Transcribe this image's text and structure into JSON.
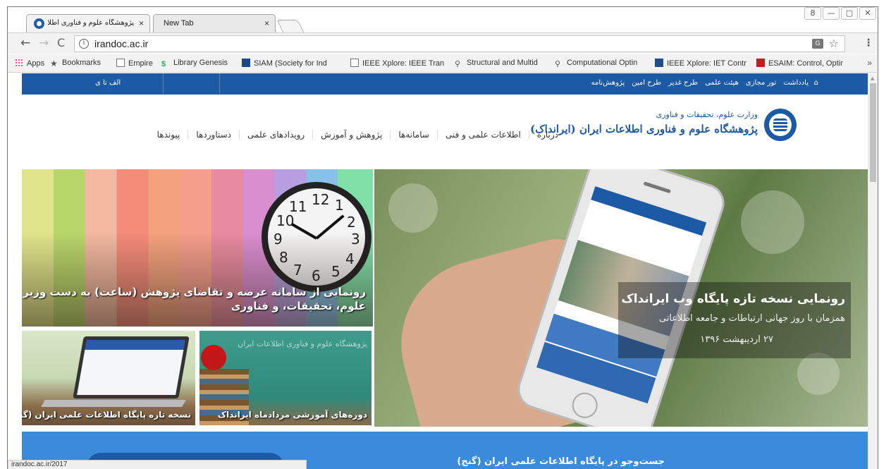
{
  "browser": {
    "tabs": [
      {
        "title": "پژوهشگاه علوم و فناوری اطلاعات ایران",
        "close": "×"
      },
      {
        "title": "New Tab",
        "close": "×"
      }
    ],
    "window_controls": [
      "8",
      "—",
      "▢",
      "✕"
    ],
    "url": "irandoc.ac.ir",
    "bookmarks": [
      {
        "label": "Apps",
        "icon": "apps-icon"
      },
      {
        "label": "Bookmarks",
        "icon": "star-icon"
      },
      {
        "label": "Empire",
        "icon": "page-icon"
      },
      {
        "label": "Library Genesis",
        "icon": "library-genesis-icon"
      },
      {
        "label": "SIAM (Society for Ind",
        "icon": "siam-icon"
      },
      {
        "label": "IEEE Xplore: IEEE Tran",
        "icon": "page-icon"
      },
      {
        "label": "Structural and Multid",
        "icon": "springer-icon"
      },
      {
        "label": "Computational Optin",
        "icon": "springer-icon"
      },
      {
        "label": "IEEE Xplore: IET Contr",
        "icon": "ieee-icon"
      },
      {
        "label": "ESAIM: Control, Optir",
        "icon": "esaim-icon"
      }
    ],
    "bookmarks_more": "»",
    "status_text": "irandoc.ac.ir/2017"
  },
  "site": {
    "topbar_links": [
      "یادداشت",
      "تور مجازی",
      "هیئت علمی",
      "طرح غدیر",
      "طرح امین",
      "پژوهش‌نامه"
    ],
    "topbar_az": "الف تا ی",
    "brand_sub": "وزارت علوم، تحقیقات و فناوری",
    "brand_main": "پژوهشگاه علوم و فناوری اطلاعات ایران (ایرانداک)",
    "nav": [
      "درباره",
      "اطلاعات علمی و فنی",
      "سامانه‌ها",
      "پژوهش و آموزش",
      "رویدادهای علمی",
      "دستاوردها",
      "پیوندها"
    ],
    "clock_numbers": [
      "12",
      "1",
      "2",
      "3",
      "4",
      "5",
      "6",
      "7",
      "8",
      "9",
      "10",
      "11"
    ],
    "tile_colors_caption": "رونمایی از سامانه عرضه و تقاضای پژوهش (ساعت) به دست وزیر علوم، تحقیقات، و فناوری",
    "phone_title": "رونمایی نسخه تازه پایگاه وب ایرانداک",
    "phone_subtitle": "همزمان با روز جهانی ارتباطات و جامعه اطلاعاتی",
    "phone_date": "۲۷ اردیبهشت ۱۳۹۶",
    "tile_laptop_caption": "نسخه تازه پایگاه اطلاعات علمی ایران (گنج)",
    "tile_board_text": "پژوهشگاه علوم و فناوری اطلاعات ایران",
    "tile_board_caption": "دوره‌های آموزشی مردادماه ایرانداک",
    "search_title": "جست‌وجو در پایگاه اطلاعات علمی ایران (گنج)"
  }
}
